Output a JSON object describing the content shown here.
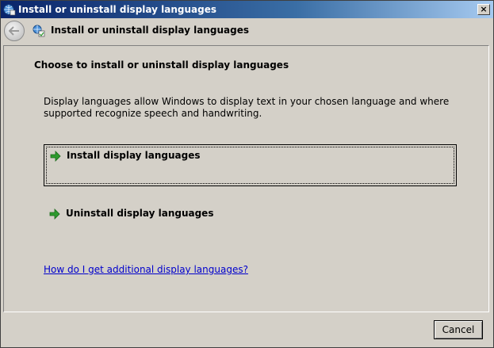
{
  "window": {
    "title": "Install or uninstall display languages",
    "close_symbol": "×"
  },
  "navbar": {
    "title": "Install or uninstall display languages"
  },
  "content": {
    "heading": "Choose to install or uninstall display languages",
    "description": "Display languages allow Windows to display text in your chosen language and where supported recognize speech and handwriting.",
    "options": [
      {
        "label": "Install display languages",
        "icon": "green-arrow-icon"
      },
      {
        "label": "Uninstall display languages",
        "icon": "green-arrow-icon"
      }
    ],
    "help_link": "How do I get additional display languages?"
  },
  "footer": {
    "cancel_label": "Cancel"
  },
  "colors": {
    "window_bg": "#d4d0c8",
    "titlebar_start": "#0a246a",
    "titlebar_end": "#a6caf0",
    "link": "#0000cc",
    "arrow_green": "#2e9a2e"
  }
}
